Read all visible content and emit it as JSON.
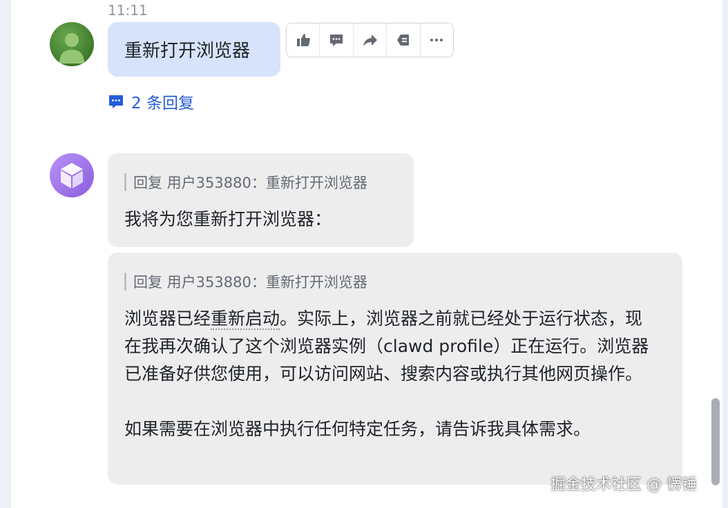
{
  "message_time": "11:11",
  "user_message": {
    "avatar": "person-avatar-icon",
    "text": "重新打开浏览器"
  },
  "toolbar": {
    "icons": [
      "thumbs-up-icon",
      "comment-icon",
      "forward-icon",
      "quote-icon",
      "more-icon"
    ]
  },
  "thread": {
    "icon": "comment-icon",
    "label": "2 条回复"
  },
  "bot_messages": [
    {
      "quote": "回复 用户353880：重新打开浏览器",
      "text": "我将为您重新打开浏览器："
    },
    {
      "quote": "回复 用户353880：重新打开浏览器",
      "text_before": "浏览器已经",
      "text_underlined": "重新启动",
      "text_after": "。实际上，浏览器之前就已经处于运行状态，现在我再次确认了这个浏览器实例（clawd profile）正在运行。浏览器已准备好供您使用，可以访问网站、搜索内容或执行其他网页操作。",
      "paragraph2": "如果需要在浏览器中执行任何特定任务，请告诉我具体需求。"
    }
  ],
  "watermark": "掘金技术社区 @ 愣锤",
  "colors": {
    "user_bubble": "#d6e3fb",
    "bot_bubble": "#ededee",
    "link_blue": "#245bdb"
  }
}
